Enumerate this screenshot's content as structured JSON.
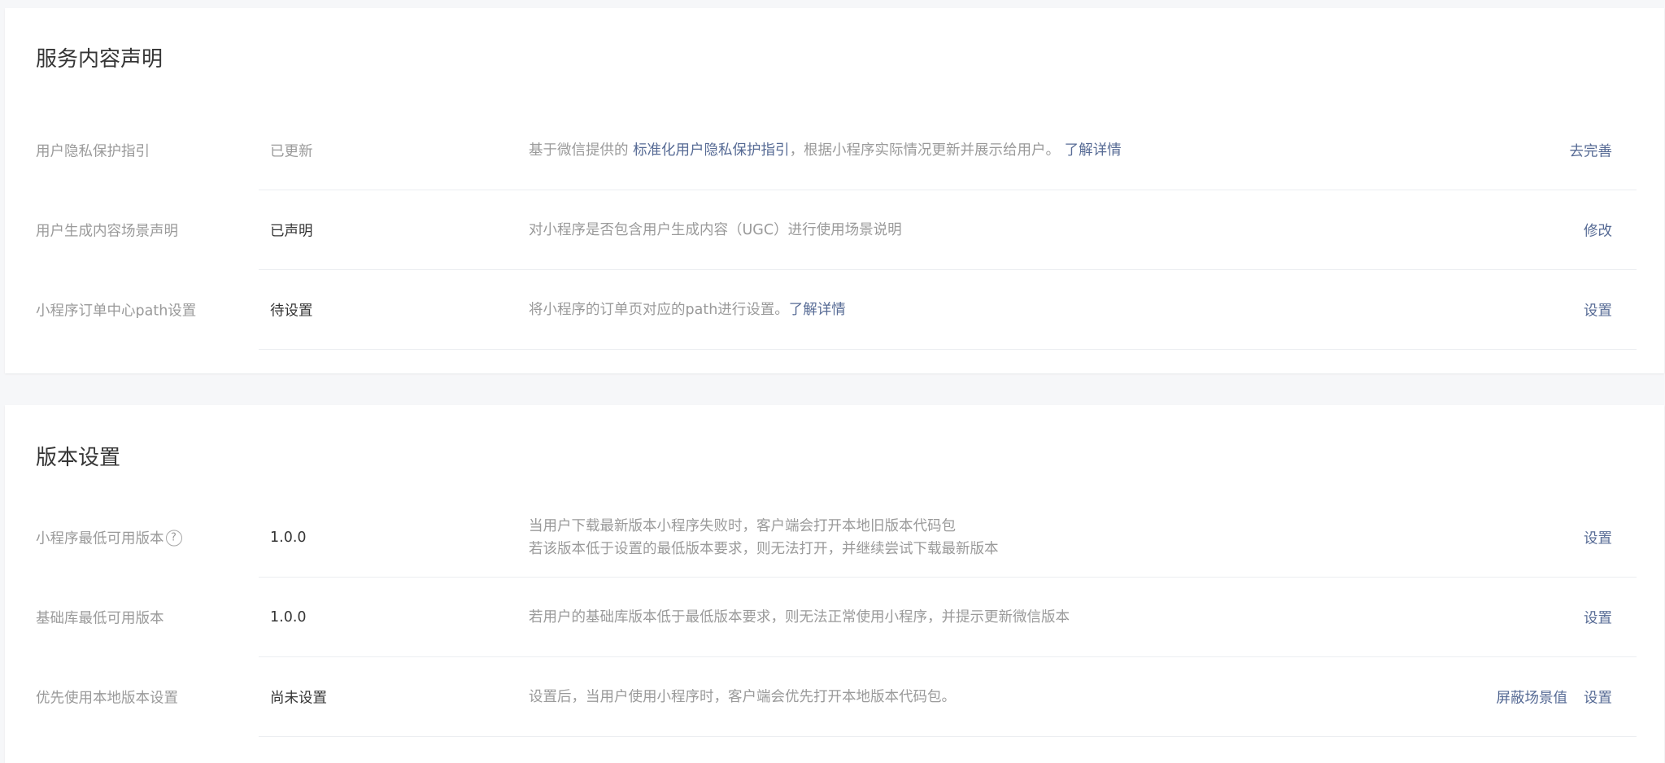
{
  "service_section": {
    "title": "服务内容声明",
    "rows": [
      {
        "label": "用户隐私保护指引",
        "status": "已更新",
        "desc_prefix": "基于微信提供的 ",
        "desc_link1": "标准化用户隐私保护指引",
        "desc_middle": "，根据小程序实际情况更新并展示给用户。",
        "desc_link2": "了解详情",
        "action": "去完善"
      },
      {
        "label": "用户生成内容场景声明",
        "status": "已声明",
        "desc": "对小程序是否包含用户生成内容（UGC）进行使用场景说明",
        "action": "修改"
      },
      {
        "label": "小程序订单中心path设置",
        "status": "待设置",
        "desc_prefix": "将小程序的订单页对应的path进行设置。",
        "desc_link": "了解详情",
        "action": "设置"
      }
    ]
  },
  "version_section": {
    "title": "版本设置",
    "rows": [
      {
        "label": "小程序最低可用版本",
        "help_glyph": "?",
        "status": "1.0.0",
        "desc_line1": "当用户下载最新版本小程序失败时，客户端会打开本地旧版本代码包",
        "desc_line2": "若该版本低于设置的最低版本要求，则无法打开，并继续尝试下载最新版本",
        "action": "设置"
      },
      {
        "label": "基础库最低可用版本",
        "status": "1.0.0",
        "desc": "若用户的基础库版本低于最低版本要求，则无法正常使用小程序，并提示更新微信版本",
        "action": "设置"
      },
      {
        "label": "优先使用本地版本设置",
        "status": "尚未设置",
        "desc": "设置后，当用户使用小程序时，客户端会优先打开本地版本代码包。",
        "action_secondary": "屏蔽场景值",
        "action": "设置"
      }
    ]
  },
  "colors": {
    "link": "#576b95",
    "muted_text": "#9a9a9a",
    "primary_text": "#353535",
    "page_background": "#f6f7f9",
    "card_background": "#ffffff"
  },
  "icons": {
    "help": "question-circle-icon"
  }
}
